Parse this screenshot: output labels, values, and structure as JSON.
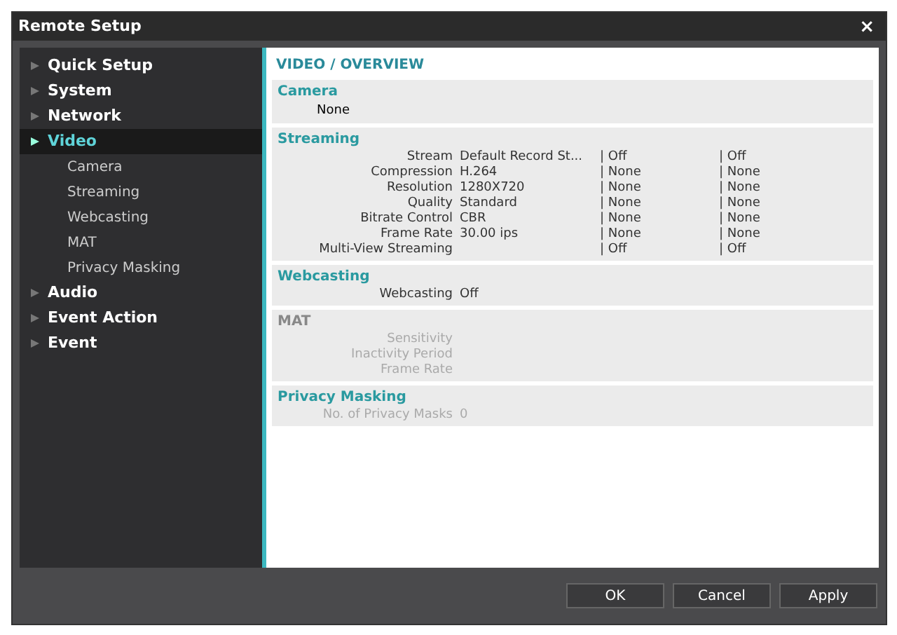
{
  "window": {
    "title": "Remote Setup",
    "close": "×"
  },
  "sidebar": {
    "items": [
      {
        "label": "Quick Setup",
        "selected": false,
        "expanded": false
      },
      {
        "label": "System",
        "selected": false,
        "expanded": false
      },
      {
        "label": "Network",
        "selected": false,
        "expanded": false
      },
      {
        "label": "Video",
        "selected": true,
        "expanded": true,
        "children": [
          {
            "label": "Camera",
            "selected": false
          },
          {
            "label": "Streaming",
            "selected": false
          },
          {
            "label": "Webcasting",
            "selected": false
          },
          {
            "label": "MAT",
            "selected": false
          },
          {
            "label": "Privacy Masking",
            "selected": false
          }
        ]
      },
      {
        "label": "Audio",
        "selected": false,
        "expanded": false
      },
      {
        "label": "Event Action",
        "selected": false,
        "expanded": false
      },
      {
        "label": "Event",
        "selected": false,
        "expanded": false
      }
    ]
  },
  "content": {
    "heading": "VIDEO / OVERVIEW",
    "sections": [
      {
        "title": "Camera",
        "disabled": false,
        "rows": [
          {
            "cells": [
              "None"
            ]
          }
        ],
        "kind": "plain"
      },
      {
        "title": "Streaming",
        "disabled": false,
        "kind": "table",
        "rows": [
          {
            "label": "Stream",
            "cells": [
              "Default Record St...",
              "| Off",
              "| Off"
            ]
          },
          {
            "label": "Compression",
            "cells": [
              "H.264",
              "| None",
              "| None"
            ]
          },
          {
            "label": "Resolution",
            "cells": [
              "1280X720",
              "| None",
              "| None"
            ]
          },
          {
            "label": "Quality",
            "cells": [
              "Standard",
              "| None",
              "| None"
            ]
          },
          {
            "label": "Bitrate Control",
            "cells": [
              "CBR",
              "| None",
              "| None"
            ]
          },
          {
            "label": "Frame Rate",
            "cells": [
              "30.00 ips",
              "| None",
              "| None"
            ]
          },
          {
            "label": "Multi-View Streaming",
            "cells": [
              "",
              "| Off",
              "| Off"
            ]
          }
        ]
      },
      {
        "title": "Webcasting",
        "disabled": false,
        "kind": "table",
        "rows": [
          {
            "label": "Webcasting",
            "cells": [
              "Off"
            ]
          }
        ]
      },
      {
        "title": "MAT",
        "disabled": true,
        "kind": "table",
        "rows": [
          {
            "label": "Sensitivity",
            "cells": []
          },
          {
            "label": "Inactivity Period",
            "cells": []
          },
          {
            "label": "Frame Rate",
            "cells": []
          }
        ]
      },
      {
        "title": "Privacy Masking",
        "disabled": false,
        "kind": "table",
        "rows": [
          {
            "label": "No. of Privacy Masks",
            "cells": [
              "0"
            ],
            "disabled": true
          }
        ]
      }
    ]
  },
  "buttons": [
    "OK",
    "Cancel",
    "Apply"
  ]
}
